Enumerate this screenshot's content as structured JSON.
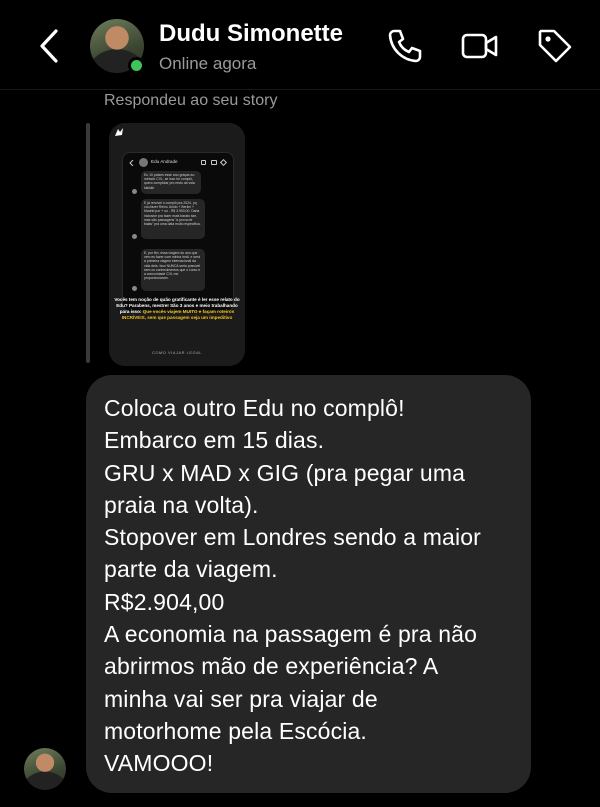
{
  "header": {
    "contact_name": "Dudu Simonette",
    "status": "Online agora",
    "icons": [
      "back-chevron-icon",
      "phone-icon",
      "video-icon",
      "tag-icon"
    ]
  },
  "reply": {
    "caption": "Respondeu ao seu story"
  },
  "story": {
    "author": "Edu Andrade",
    "bubbles": [
      "Eu 10 países esse ano graças ao método CVL, se isso for complô, quero complotar pro resto da vida kkkkkk",
      "E já renovei o complô pra 2024, pq vou fazer Reino Unido + Berlim + Madrid por + ou - R$ 3.900,00. Darla inclusive pra fazer mais barato sim, mas são passagens \"a prova de balas\" pra uma data muito específica.",
      "E, por fim, essa viagem do ano que vem eu fazer com minha irmã, e será a primeira viagem internacional da vida dela. Isso NUNCA seria possível sem os conhecimentos que o curso e a comunidade CVL me proporcionaram."
    ],
    "caption_plain": "Vocês tem noção de quão gratificante é ler esse relato do Edu? Parabens, mestre! São 3 anos e meio trabalhando para isso:",
    "caption_highlight": "Que vocês viajem MUITO e façam roteiros INCRÍVEIS, sem que passagem seja um impeditivo",
    "logo_text": "COMO VIAJAR LEGAL"
  },
  "message": {
    "lines": [
      "Coloca outro Edu no complô!",
      "Embarco em 15 dias.",
      "GRU x MAD x GIG (pra pegar uma",
      "praia na volta).",
      "Stopover em Londres sendo a maior",
      "parte da viagem.",
      "R$2.904,00",
      "A economia na passagem é pra não",
      "abrirmos mão de experiência? A",
      "minha vai ser pra viajar de",
      "motorhome pela Escócia.",
      "VAMOOO!"
    ]
  },
  "colors": {
    "background": "#000000",
    "bubble": "#262626",
    "online": "#3fc45a",
    "muted_text": "#9a9a9a",
    "highlight": "#f2c21a"
  }
}
